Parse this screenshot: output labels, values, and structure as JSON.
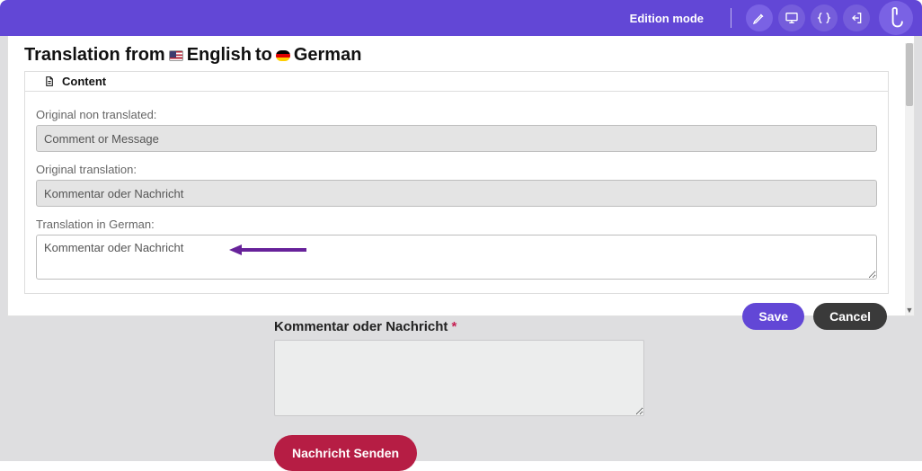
{
  "toolbar": {
    "mode_label": "Edition mode"
  },
  "modal": {
    "title_prefix": "Translation from",
    "lang_from": "English",
    "title_mid": "to",
    "lang_to": "German",
    "tab_label": "Content",
    "fields": {
      "original_non_translated": {
        "label": "Original non translated:",
        "value": "Comment or Message"
      },
      "original_translation": {
        "label": "Original translation:",
        "value": "Kommentar oder Nachricht"
      },
      "translation_in": {
        "label": "Translation in German:",
        "value": "Kommentar oder Nachricht"
      }
    },
    "save_label": "Save",
    "cancel_label": "Cancel"
  },
  "page": {
    "field_label": "Kommentar oder Nachricht",
    "required_mark": "*",
    "send_label": "Nachricht Senden"
  },
  "colors": {
    "accent": "#6247d6",
    "brand_red": "#b61d44",
    "annotation": "#67229a"
  }
}
